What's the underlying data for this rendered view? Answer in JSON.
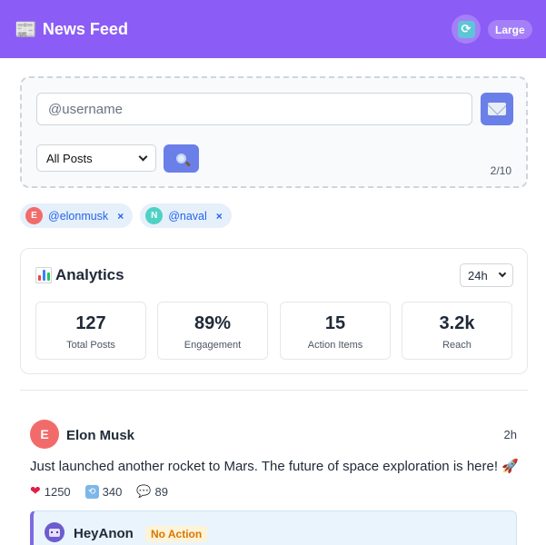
{
  "header": {
    "icon": "newspaper-icon",
    "title": "News Feed",
    "refresh_icon": "refresh-icon",
    "size_label": "Large"
  },
  "compose": {
    "username_placeholder": "@username",
    "send_icon": "envelope-icon",
    "filter_selected": "All Posts",
    "search_icon": "magnifier-icon",
    "counter": "2/10"
  },
  "tracked_accounts": [
    {
      "initial": "E",
      "handle": "@elonmusk",
      "remove": "×",
      "color": "#f26b6b"
    },
    {
      "initial": "N",
      "handle": "@naval",
      "remove": "×",
      "color": "#4fd1c5"
    }
  ],
  "analytics": {
    "icon": "bar-chart-icon",
    "title": "Analytics",
    "range": "24h",
    "stats": [
      {
        "value": "127",
        "label": "Total Posts"
      },
      {
        "value": "89%",
        "label": "Engagement"
      },
      {
        "value": "15",
        "label": "Action Items"
      },
      {
        "value": "3.2k",
        "label": "Reach"
      }
    ]
  },
  "post": {
    "initial": "E",
    "author": "Elon Musk",
    "time": "2h",
    "text": "Just launched another rocket to Mars. The future of space exploration is here!",
    "text_emoji": "🚀",
    "likes": "1250",
    "reposts": "340",
    "comments": "89",
    "reply": {
      "name": "HeyAnon",
      "badge": "No Action",
      "avatar_icon": "robot-icon"
    }
  },
  "colors": {
    "header_bg": "#8b5cf6",
    "accent_button": "#6b7fe8",
    "tag_bg": "#e6f0fb",
    "link": "#2563eb",
    "badge_text": "#d97706"
  }
}
